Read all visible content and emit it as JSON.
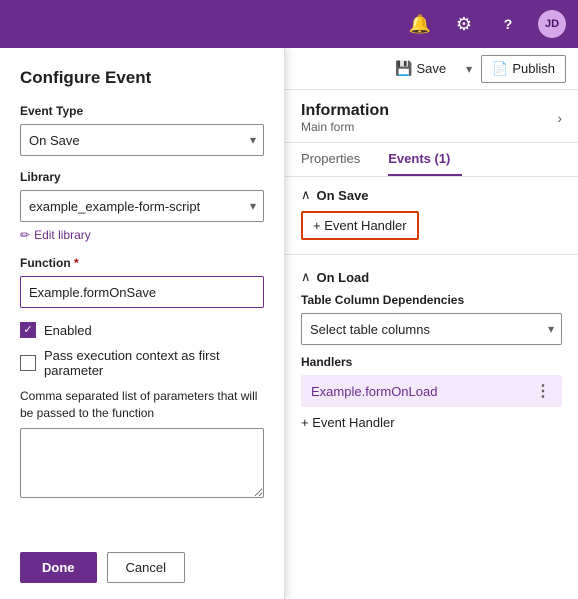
{
  "header": {
    "bell_icon": "🔔",
    "gear_icon": "⚙",
    "help_icon": "?",
    "avatar_text": "JD",
    "bg_color": "#6b2d8b"
  },
  "toolbar": {
    "save_label": "Save",
    "publish_label": "Publish",
    "save_icon": "💾",
    "publish_icon": "📄"
  },
  "info": {
    "title": "Information",
    "subtitle": "Main form"
  },
  "tabs": [
    {
      "id": "properties",
      "label": "Properties",
      "active": false
    },
    {
      "id": "events",
      "label": "Events (1)",
      "active": true
    }
  ],
  "configure_event": {
    "title": "Configure Event",
    "event_type_label": "Event Type",
    "event_type_value": "On Save",
    "library_label": "Library",
    "library_value": "example_example-form-script",
    "edit_library_label": "Edit library",
    "function_label": "Function",
    "function_required": true,
    "function_value": "Example.formOnSave",
    "function_placeholder": "Example.formOnSave",
    "enabled_label": "Enabled",
    "enabled_checked": true,
    "pass_context_label": "Pass execution context as first parameter",
    "pass_context_checked": false,
    "params_description": "Comma separated list of parameters that will be passed to the function",
    "params_value": "",
    "done_label": "Done",
    "cancel_label": "Cancel"
  },
  "events": {
    "on_save": {
      "title": "On Save",
      "event_handler_label": "+ Event Handler",
      "highlighted": true
    },
    "on_load": {
      "title": "On Load",
      "table_col_label": "Table Column Dependencies",
      "select_placeholder": "Select table columns",
      "handlers_label": "Handlers",
      "handler_name": "Example.formOnLoad",
      "add_handler_label": "+ Event Handler"
    }
  }
}
